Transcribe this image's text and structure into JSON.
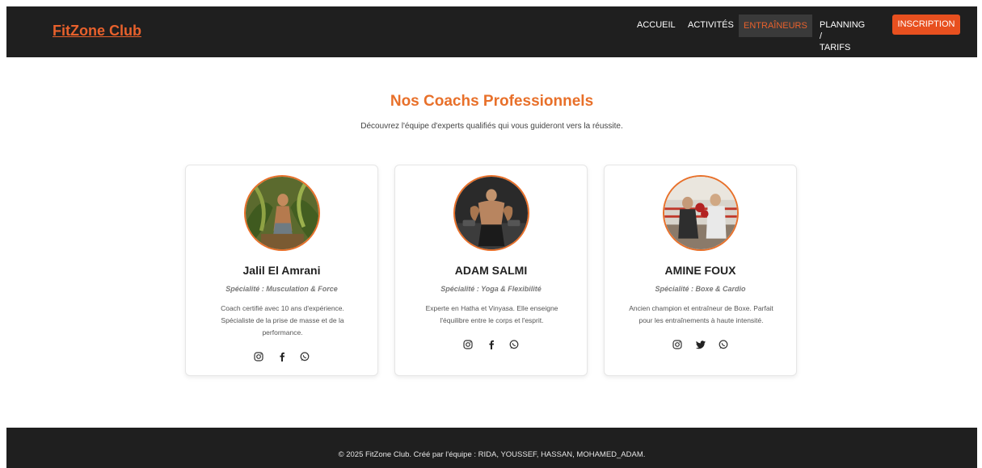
{
  "header": {
    "logo": "FitZone Club",
    "nav": [
      {
        "label": "ACCUEIL"
      },
      {
        "label": "ACTIVITÉS"
      },
      {
        "label": "ENTRAÎNEURS"
      },
      {
        "label_line1": "PLANNING /",
        "label_line2": "TARIFS"
      }
    ],
    "cta": "INSCRIPTION",
    "accent_color": "#e8612c"
  },
  "main": {
    "title": "Nos Coachs Professionnels",
    "subtitle": "Découvrez l'équipe d'experts qualifiés qui vous guideront vers la réussite.",
    "coaches": [
      {
        "name": "Jalil El Amrani",
        "specialty": "Spécialité : Musculation & Force",
        "desc_lines": [
          "Coach certifié avec 10 ans d'expérience.",
          "Spécialiste de la prise de masse et de la",
          "performance."
        ],
        "socials": [
          "instagram-icon",
          "facebook-icon",
          "whatsapp-icon"
        ]
      },
      {
        "name": "ADAM SALMI",
        "specialty": "Spécialité : Yoga & Flexibilité",
        "desc_lines": [
          "Experte en Hatha et Vinyasa. Elle enseigne",
          "l'équilibre entre le corps et l'esprit."
        ],
        "socials": [
          "instagram-icon",
          "facebook-icon",
          "whatsapp-icon"
        ]
      },
      {
        "name": "AMINE FOUX",
        "specialty": "Spécialité : Boxe & Cardio",
        "desc_lines": [
          "Ancien champion et entraîneur de Boxe. Parfait",
          "pour les entraînements à haute intensité."
        ],
        "socials": [
          "instagram-icon",
          "twitter-icon",
          "whatsapp-icon"
        ]
      }
    ]
  },
  "footer": {
    "text": "© 2025 FitZone Club. Créé par l'équipe : RIDA, YOUSSEF, HASSAN, MOHAMED_ADAM."
  }
}
